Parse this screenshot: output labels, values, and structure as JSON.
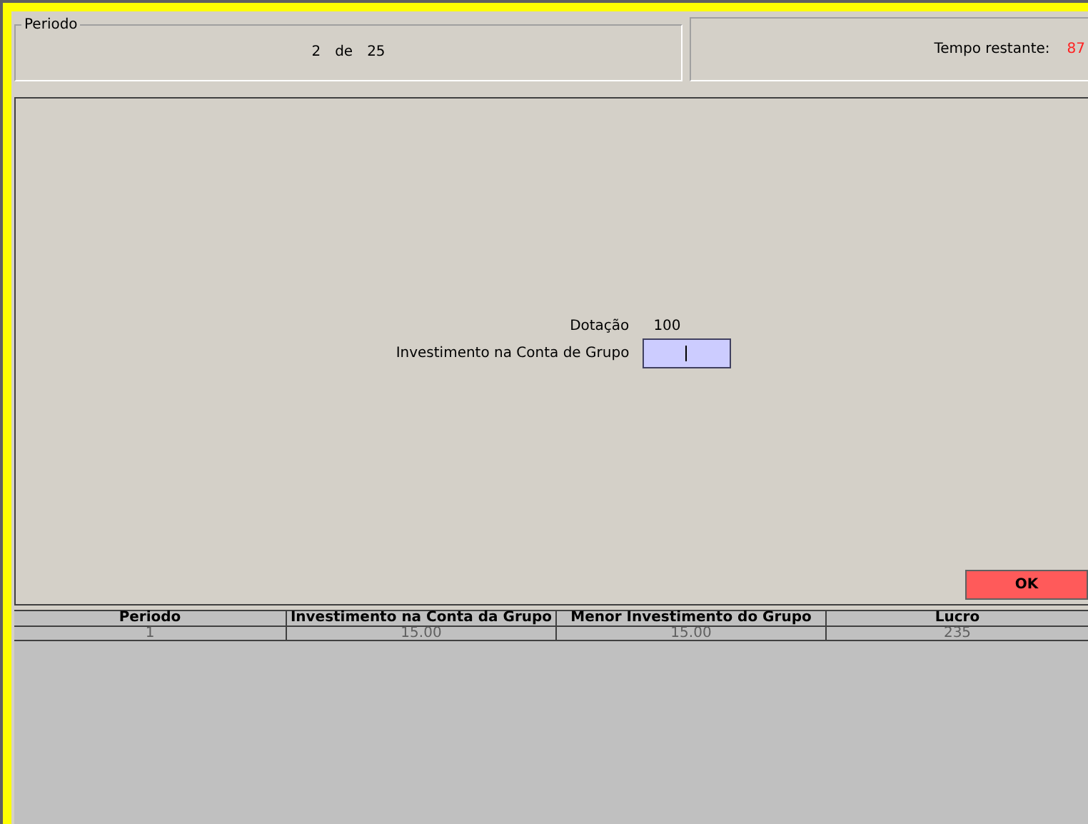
{
  "period_panel": {
    "title": "Periodo",
    "current": "2",
    "separator": "de",
    "total": "25"
  },
  "timer_panel": {
    "label": "Tempo restante:",
    "value": "87"
  },
  "form": {
    "endowment_label": "Dotação",
    "endowment_value": "100",
    "investment_label": "Investimento na Conta de Grupo",
    "investment_focused": true
  },
  "ok_button": {
    "label": "OK"
  },
  "table": {
    "columns": [
      "Periodo",
      "Investimento na Conta da Grupo",
      "Menor Investimento do Grupo",
      "Lucro"
    ],
    "rows": [
      [
        "1",
        "15.00",
        "15.00",
        "235"
      ]
    ]
  }
}
